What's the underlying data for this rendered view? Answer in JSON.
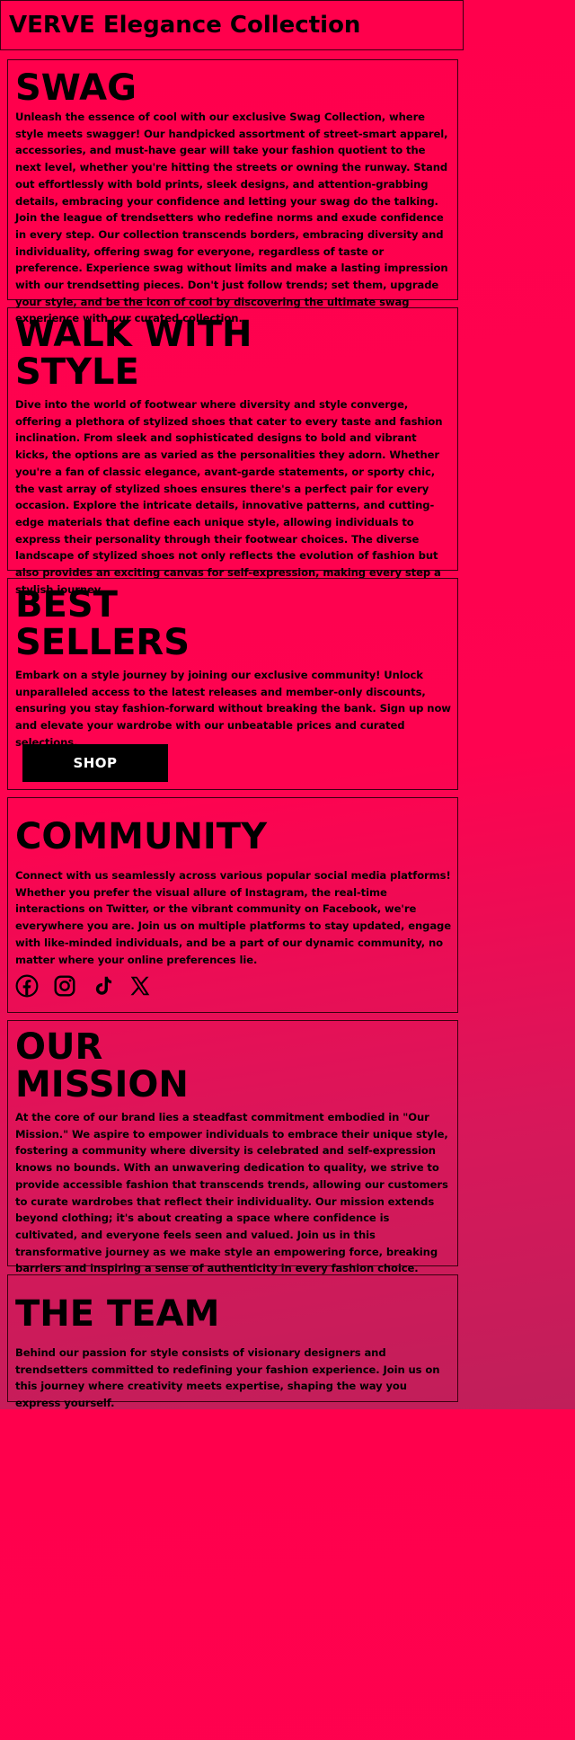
{
  "header": {
    "title": "VERVE Elegance Collection"
  },
  "sections": {
    "swag": {
      "heading": "SWAG",
      "body": "Unleash the essence of cool with our exclusive Swag Collection, where style meets swagger! Our handpicked assortment of street-smart apparel, accessories, and must-have gear will take your fashion quotient to the next level, whether you're hitting the streets or owning the runway. Stand out effortlessly with bold prints, sleek designs, and attention-grabbing details, embracing your confidence and letting your swag do the talking. Join the league of trendsetters who redefine norms and exude confidence in every step. Our collection transcends borders, embracing diversity and individuality, offering swag for everyone, regardless of taste or preference. Experience swag without limits and make a lasting impression with our trendsetting pieces. Don't just follow trends; set them, upgrade your style, and be the icon of cool by discovering the ultimate swag experience with our curated collection."
    },
    "walk": {
      "heading": "WALK WITH\nSTYLE",
      "body": "Dive into the world of footwear where diversity and style converge, offering a plethora of stylized shoes that cater to every taste and fashion inclination. From sleek and sophisticated designs to bold and vibrant kicks, the options are as varied as the personalities they adorn. Whether you're a fan of classic elegance, avant-garde statements, or sporty chic, the vast array of stylized shoes ensures there's a perfect pair for every occasion. Explore the intricate details, innovative patterns, and cutting-edge materials that define each unique style, allowing individuals to express their personality through their footwear choices. The diverse landscape of stylized shoes not only reflects the evolution of fashion but also provides an exciting canvas for self-expression, making every step a stylish journey."
    },
    "bestsellers": {
      "heading": "BEST\nSELLERS",
      "body": "Embark on a style journey by joining our exclusive community! Unlock unparalleled access to the latest releases and member-only discounts, ensuring you stay fashion-forward without breaking the bank. Sign up now and elevate your wardrobe with our unbeatable prices and curated selections.",
      "button_label": "SHOP"
    },
    "community": {
      "heading": "COMMUNITY",
      "body": "Connect with us seamlessly across various popular social media platforms! Whether you prefer the visual allure of Instagram, the real-time interactions on Twitter, or the vibrant community on Facebook, we're everywhere you are. Join us on multiple platforms to stay updated, engage with like-minded individuals, and be a part of our dynamic community, no matter where your online preferences lie.",
      "social_icons": [
        "facebook-icon",
        "instagram-icon",
        "tiktok-icon",
        "x-icon"
      ]
    },
    "mission": {
      "heading": "OUR\nMISSION",
      "body": "At the core of our brand lies a steadfast commitment embodied in \"Our Mission.\" We aspire to empower individuals to embrace their unique style, fostering a community where diversity is celebrated and self-expression knows no bounds. With an unwavering dedication to quality, we strive to provide accessible fashion that transcends trends, allowing our customers to curate wardrobes that reflect their individuality. Our mission extends beyond clothing; it's about creating a space where confidence is cultivated, and everyone feels seen and valued. Join us in this transformative journey as we make style an empowering force, breaking barriers and inspiring a sense of authenticity in every fashion choice."
    },
    "team": {
      "heading": "THE TEAM",
      "body": "Behind our passion for style consists of visionary designers and trendsetters committed to redefining your fashion experience. Join us on this journey where creativity meets expertise, shaping the way you express yourself."
    }
  },
  "colors": {
    "background": "#ff004c",
    "text": "#000000",
    "button_bg": "#000000",
    "button_text": "#ffffff"
  }
}
